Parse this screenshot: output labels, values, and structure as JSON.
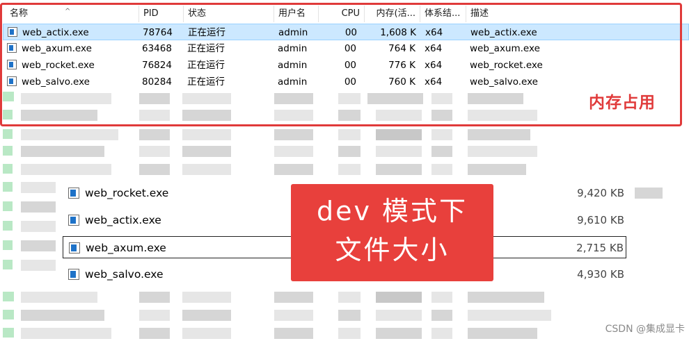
{
  "columns": [
    {
      "key": "name",
      "label": "名称"
    },
    {
      "key": "pid",
      "label": "PID"
    },
    {
      "key": "status",
      "label": "状态"
    },
    {
      "key": "user",
      "label": "用户名"
    },
    {
      "key": "cpu",
      "label": "CPU"
    },
    {
      "key": "mem",
      "label": "内存(活..."
    },
    {
      "key": "arch",
      "label": "体系结..."
    },
    {
      "key": "desc",
      "label": "描述"
    }
  ],
  "processes": [
    {
      "name": "web_actix.exe",
      "pid": "78764",
      "status": "正在运行",
      "user": "admin",
      "cpu": "00",
      "mem": "1,608 K",
      "arch": "x64",
      "desc": "web_actix.exe"
    },
    {
      "name": "web_axum.exe",
      "pid": "63468",
      "status": "正在运行",
      "user": "admin",
      "cpu": "00",
      "mem": "764 K",
      "arch": "x64",
      "desc": "web_axum.exe"
    },
    {
      "name": "web_rocket.exe",
      "pid": "76824",
      "status": "正在运行",
      "user": "admin",
      "cpu": "00",
      "mem": "776 K",
      "arch": "x64",
      "desc": "web_rocket.exe"
    },
    {
      "name": "web_salvo.exe",
      "pid": "80284",
      "status": "正在运行",
      "user": "admin",
      "cpu": "00",
      "mem": "760 K",
      "arch": "x64",
      "desc": "web_salvo.exe"
    }
  ],
  "memory_annotation": "内存占用",
  "files": [
    {
      "name": "web_rocket.exe",
      "size": "9,420 KB"
    },
    {
      "name": "web_actix.exe",
      "size": "9,610 KB"
    },
    {
      "name": "web_axum.exe",
      "size": "2,715 KB"
    },
    {
      "name": "web_salvo.exe",
      "size": "4,930 KB"
    }
  ],
  "callout": {
    "line1": "dev 模式下",
    "line2": "文件大小"
  },
  "watermark": "CSDN @集成显卡",
  "colors": {
    "annotation_red": "#e03a3a",
    "selection": "#cce8ff",
    "file_icon": "#1e72c8"
  }
}
